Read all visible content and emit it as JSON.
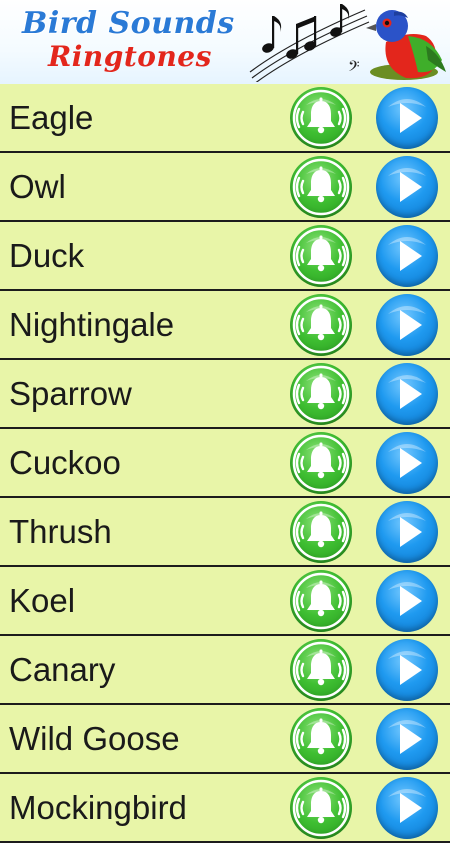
{
  "header": {
    "title_line1": "Bird Sounds",
    "title_line2": "Ringtones",
    "colors": {
      "title_line1": "#2a7ad6",
      "title_line2": "#e3261c"
    }
  },
  "list": {
    "items": [
      {
        "label": "Eagle"
      },
      {
        "label": "Owl"
      },
      {
        "label": "Duck"
      },
      {
        "label": "Nightingale"
      },
      {
        "label": "Sparrow"
      },
      {
        "label": "Cuckoo"
      },
      {
        "label": "Thrush"
      },
      {
        "label": "Koel"
      },
      {
        "label": "Canary"
      },
      {
        "label": "Wild Goose"
      },
      {
        "label": "Mockingbird"
      }
    ],
    "row_background": "#e8f5a8",
    "set_ringtone_icon": "bell-icon",
    "play_icon": "play-icon",
    "set_ringtone_button_color": "#3fbf32",
    "play_button_color": "#1f9af0"
  }
}
